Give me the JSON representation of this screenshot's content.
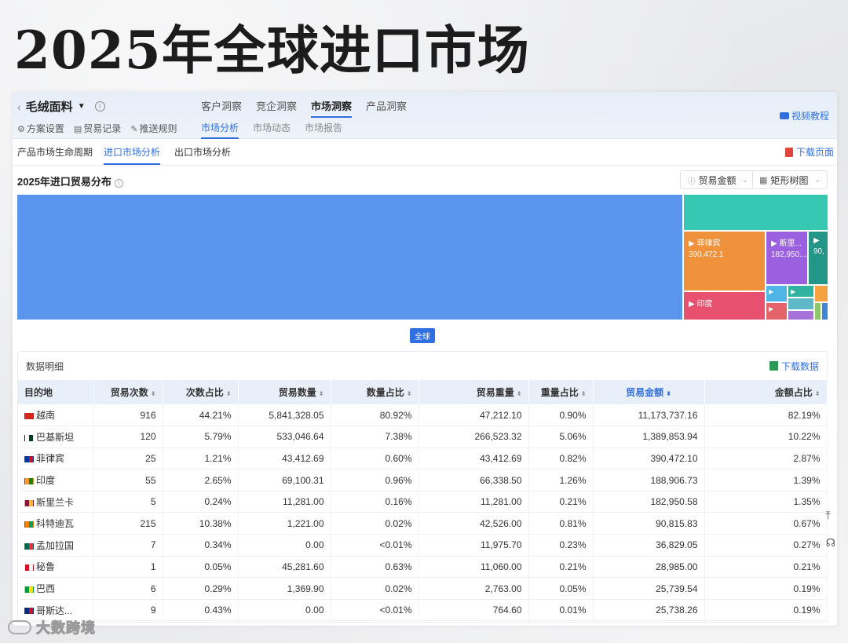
{
  "headline": "2025年全球进口市场",
  "header": {
    "product_name": "毛绒面料",
    "actions": [
      "方案设置",
      "贸易记录",
      "推送规则"
    ],
    "nav_tabs": [
      "客户洞察",
      "竞企洞察",
      "市场洞察",
      "产品洞察"
    ],
    "active_nav": "市场洞察",
    "sub_tabs": [
      "市场分析",
      "市场动态",
      "市场报告"
    ],
    "active_sub": "市场分析",
    "video_label": "视频教程"
  },
  "secondary_tabs": [
    "产品市场生命周期",
    "进口市场分析",
    "出口市场分析"
  ],
  "active_secondary": "进口市场分析",
  "download_page_label": "下载页面",
  "distribution": {
    "title": "2025年进口贸易分布",
    "metric_select": "贸易金额",
    "view_select": "矩形树图",
    "root_label": "全球",
    "treemap": [
      {
        "label": "",
        "value": null,
        "color": "#5b96ee"
      },
      {
        "label": "",
        "value": null,
        "color": "#37c8b4"
      },
      {
        "label": "菲律宾",
        "value": "390,472.1",
        "color": "#f0913c"
      },
      {
        "label": "斯里...",
        "value": "182,950....",
        "color": "#9b60e0"
      },
      {
        "label": "",
        "value": "90,",
        "color": "#239688"
      },
      {
        "label": "印度",
        "value": "",
        "color": "#e8506f"
      }
    ],
    "treemap_small_colors": [
      "#4fb5e6",
      "#2fb3a0",
      "#f4a340",
      "#e4636b",
      "#5fb8c8",
      "#a773d8",
      "#8ec66a",
      "#3f86d8"
    ]
  },
  "table": {
    "title": "数据明细",
    "download_label": "下载数据",
    "columns": [
      "目的地",
      "贸易次数",
      "次数占比",
      "贸易数量",
      "数量占比",
      "贸易重量",
      "重量占比",
      "贸易金额",
      "金额占比"
    ],
    "sorted_column": "贸易金额",
    "rows": [
      {
        "dest": "越南",
        "flag": [
          "#da251d",
          "#da251d"
        ],
        "count": "916",
        "count_pct": "44.21%",
        "qty": "5,841,328.05",
        "qty_pct": "80.92%",
        "weight": "47,212.10",
        "weight_pct": "0.90%",
        "amount": "11,173,737.16",
        "amount_pct": "82.19%"
      },
      {
        "dest": "巴基斯坦",
        "flag": [
          "#ffffff",
          "#01411c"
        ],
        "count": "120",
        "count_pct": "5.79%",
        "qty": "533,046.64",
        "qty_pct": "7.38%",
        "weight": "266,523.32",
        "weight_pct": "5.06%",
        "amount": "1,389,853.94",
        "amount_pct": "10.22%"
      },
      {
        "dest": "菲律宾",
        "flag": [
          "#0038a8",
          "#ce1126"
        ],
        "count": "25",
        "count_pct": "1.21%",
        "qty": "43,412.69",
        "qty_pct": "0.60%",
        "weight": "43,412.69",
        "weight_pct": "0.82%",
        "amount": "390,472.10",
        "amount_pct": "2.87%"
      },
      {
        "dest": "印度",
        "flag": [
          "#ff9933",
          "#138808"
        ],
        "count": "55",
        "count_pct": "2.65%",
        "qty": "69,100.31",
        "qty_pct": "0.96%",
        "weight": "66,338.50",
        "weight_pct": "1.26%",
        "amount": "188,906.73",
        "amount_pct": "1.39%"
      },
      {
        "dest": "斯里兰卡",
        "flag": [
          "#8d153a",
          "#ffbe29"
        ],
        "count": "5",
        "count_pct": "0.24%",
        "qty": "11,281.00",
        "qty_pct": "0.16%",
        "weight": "11,281.00",
        "weight_pct": "0.21%",
        "amount": "182,950.58",
        "amount_pct": "1.35%"
      },
      {
        "dest": "科特迪瓦",
        "flag": [
          "#f77f00",
          "#009e60"
        ],
        "count": "215",
        "count_pct": "10.38%",
        "qty": "1,221.00",
        "qty_pct": "0.02%",
        "weight": "42,526.00",
        "weight_pct": "0.81%",
        "amount": "90,815.83",
        "amount_pct": "0.67%"
      },
      {
        "dest": "孟加拉国",
        "flag": [
          "#006a4e",
          "#f42a41"
        ],
        "count": "7",
        "count_pct": "0.34%",
        "qty": "0.00",
        "qty_pct": "<0.01%",
        "weight": "11,975.70",
        "weight_pct": "0.23%",
        "amount": "36,829.05",
        "amount_pct": "0.27%"
      },
      {
        "dest": "秘鲁",
        "flag": [
          "#d91023",
          "#ffffff"
        ],
        "count": "1",
        "count_pct": "0.05%",
        "qty": "45,281.60",
        "qty_pct": "0.63%",
        "weight": "11,060.00",
        "weight_pct": "0.21%",
        "amount": "28,985.00",
        "amount_pct": "0.21%"
      },
      {
        "dest": "巴西",
        "flag": [
          "#009c3b",
          "#ffdf00"
        ],
        "count": "6",
        "count_pct": "0.29%",
        "qty": "1,369.90",
        "qty_pct": "0.02%",
        "weight": "2,763.00",
        "weight_pct": "0.05%",
        "amount": "25,739.54",
        "amount_pct": "0.19%"
      },
      {
        "dest": "哥斯达...",
        "flag": [
          "#002b7f",
          "#ce1126"
        ],
        "count": "9",
        "count_pct": "0.43%",
        "qty": "0.00",
        "qty_pct": "<0.01%",
        "weight": "764.60",
        "weight_pct": "0.01%",
        "amount": "25,738.26",
        "amount_pct": "0.19%"
      }
    ]
  },
  "watermark": "大数跨境"
}
